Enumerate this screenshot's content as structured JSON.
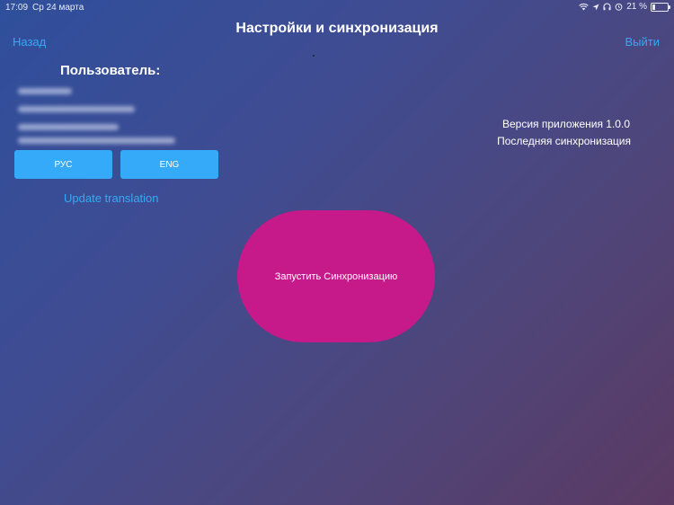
{
  "status_bar": {
    "time": "17:09",
    "date": "Ср 24 марта",
    "battery": "21 %",
    "battery_fraction": 0.21,
    "icons": [
      "wifi-icon",
      "location-icon",
      "headphones-icon",
      "alarm-icon",
      "battery-icon"
    ]
  },
  "nav": {
    "title": "Настройки и синхронизация",
    "back_label": "Назад",
    "exit_label": "Выйти"
  },
  "user": {
    "heading": "Пользователь:"
  },
  "language": {
    "ru_label": "РУС",
    "en_label": "ENG",
    "update_label": "Update translation"
  },
  "app_info": {
    "version": "Версия приложения 1.0.0",
    "last_sync": "Последняя синхронизация"
  },
  "sync_button": {
    "label": "Запустить Синхронизацию"
  },
  "colors": {
    "accent": "#35aaf2",
    "button_blue": "#35aaf9",
    "sync_button": "#c6198a"
  }
}
